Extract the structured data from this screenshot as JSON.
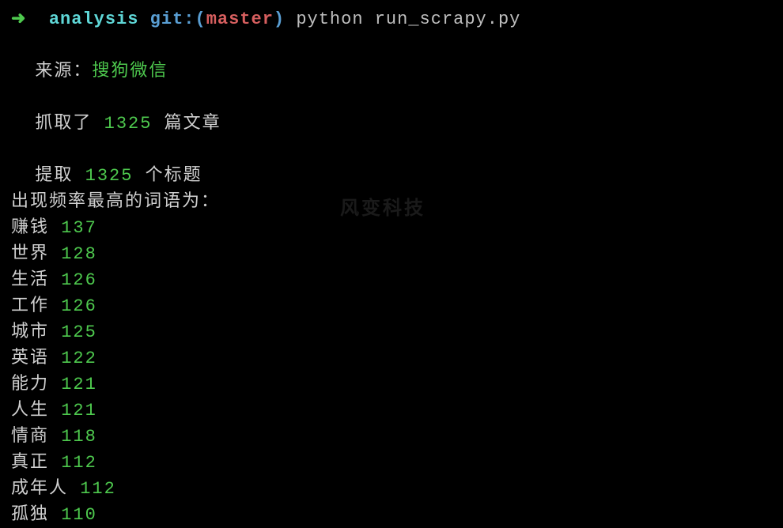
{
  "prompt": {
    "arrow": "➜",
    "directory": "analysis",
    "git_prefix": "git:(",
    "git_branch": "master",
    "git_suffix": ")",
    "command": "python run_scrapy.py"
  },
  "source": {
    "label": "来源：",
    "value": "搜狗微信"
  },
  "fetched": {
    "prefix": "抓取了",
    "count": "1325",
    "suffix": "篇文章"
  },
  "extracted": {
    "prefix": "提取",
    "count": "1325",
    "suffix": "个标题"
  },
  "frequency_header": "出现频率最高的词语为：",
  "words": [
    {
      "term": "赚钱",
      "count": "137"
    },
    {
      "term": "世界",
      "count": "128"
    },
    {
      "term": "生活",
      "count": "126"
    },
    {
      "term": "工作",
      "count": "126"
    },
    {
      "term": "城市",
      "count": "125"
    },
    {
      "term": "英语",
      "count": "122"
    },
    {
      "term": "能力",
      "count": "121"
    },
    {
      "term": "人生",
      "count": "121"
    },
    {
      "term": "情商",
      "count": "118"
    },
    {
      "term": "真正",
      "count": "112"
    },
    {
      "term": "成年人",
      "count": "112"
    },
    {
      "term": "孤独",
      "count": "110"
    }
  ],
  "watermark": "风变科技"
}
